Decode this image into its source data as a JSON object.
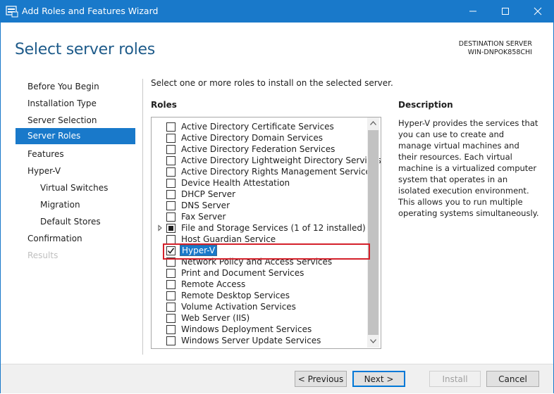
{
  "window": {
    "title": "Add Roles and Features Wizard",
    "accent_color": "#1979ca"
  },
  "header": {
    "page_title": "Select server roles",
    "destination_label": "DESTINATION SERVER",
    "destination_name": "WIN-DNPOK858CHI"
  },
  "nav": {
    "items": [
      {
        "label": "Before You Begin",
        "state": "normal",
        "level": 0
      },
      {
        "label": "Installation Type",
        "state": "normal",
        "level": 0
      },
      {
        "label": "Server Selection",
        "state": "normal",
        "level": 0
      },
      {
        "label": "Server Roles",
        "state": "active",
        "level": 0
      },
      {
        "label": "Features",
        "state": "normal",
        "level": 0
      },
      {
        "label": "Hyper-V",
        "state": "normal",
        "level": 0
      },
      {
        "label": "Virtual Switches",
        "state": "normal",
        "level": 1
      },
      {
        "label": "Migration",
        "state": "normal",
        "level": 1
      },
      {
        "label": "Default Stores",
        "state": "normal",
        "level": 1
      },
      {
        "label": "Confirmation",
        "state": "normal",
        "level": 0
      },
      {
        "label": "Results",
        "state": "disabled",
        "level": 0
      }
    ]
  },
  "main": {
    "instruction": "Select one or more roles to install on the selected server.",
    "roles_heading": "Roles",
    "roles": [
      {
        "label": "Active Directory Certificate Services",
        "checked": false
      },
      {
        "label": "Active Directory Domain Services",
        "checked": false
      },
      {
        "label": "Active Directory Federation Services",
        "checked": false
      },
      {
        "label": "Active Directory Lightweight Directory Services",
        "checked": false
      },
      {
        "label": "Active Directory Rights Management Services",
        "checked": false
      },
      {
        "label": "Device Health Attestation",
        "checked": false
      },
      {
        "label": "DHCP Server",
        "checked": false
      },
      {
        "label": "DNS Server",
        "checked": false
      },
      {
        "label": "Fax Server",
        "checked": false
      },
      {
        "label": "File and Storage Services (1 of 12 installed)",
        "checked": "partial",
        "expandable": true
      },
      {
        "label": "Host Guardian Service",
        "checked": false
      },
      {
        "label": "Hyper-V",
        "checked": true,
        "selected": true
      },
      {
        "label": "Network Policy and Access Services",
        "checked": false
      },
      {
        "label": "Print and Document Services",
        "checked": false
      },
      {
        "label": "Remote Access",
        "checked": false
      },
      {
        "label": "Remote Desktop Services",
        "checked": false
      },
      {
        "label": "Volume Activation Services",
        "checked": false
      },
      {
        "label": "Web Server (IIS)",
        "checked": false
      },
      {
        "label": "Windows Deployment Services",
        "checked": false
      },
      {
        "label": "Windows Server Update Services",
        "checked": false
      }
    ],
    "description_heading": "Description",
    "description_text": "Hyper-V provides the services that you can use to create and manage virtual machines and their resources. Each virtual machine is a virtualized computer system that operates in an isolated execution environment. This allows you to run multiple operating systems simultaneously."
  },
  "footer": {
    "previous_label": "< Previous",
    "next_label": "Next >",
    "install_label": "Install",
    "cancel_label": "Cancel"
  },
  "icons": {
    "app": "server-manager-icon",
    "minimize": "minimize-icon",
    "maximize": "maximize-icon",
    "close": "close-icon",
    "expander": "triangle-right-icon",
    "check": "checkmark-icon",
    "scroll_up": "chevron-up-icon",
    "scroll_down": "chevron-down-icon"
  },
  "highlight_color": "#d4202a"
}
